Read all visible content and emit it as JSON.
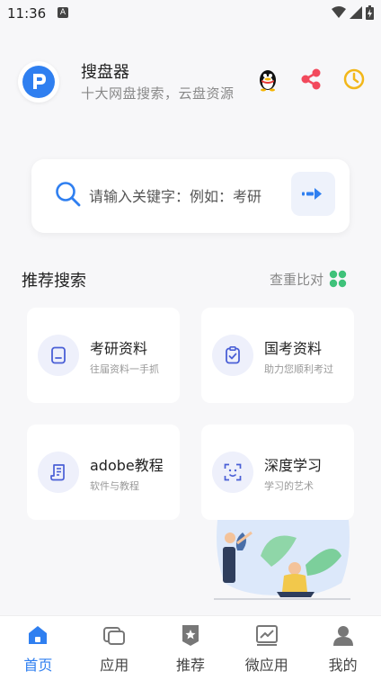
{
  "status": {
    "time": "11:36",
    "notification_glyph": "A"
  },
  "header": {
    "title": "搜盘器",
    "subtitle": "十大网盘搜索，云盘资源",
    "icons": [
      "penguin-icon",
      "share-icon",
      "history-icon"
    ]
  },
  "search": {
    "placeholder": "请输入关键字：例如：考研"
  },
  "section": {
    "title": "推荐搜索",
    "link": "查重比对"
  },
  "cards": [
    {
      "title": "考研资料",
      "subtitle": "往届资料一手抓",
      "icon": "document-icon"
    },
    {
      "title": "国考资料",
      "subtitle": "助力您顺利考过",
      "icon": "clipboard-check-icon"
    },
    {
      "title": "adobe教程",
      "subtitle": "软件与教程",
      "icon": "scroll-icon"
    },
    {
      "title": "深度学习",
      "subtitle": "学习的艺术",
      "icon": "face-scan-icon"
    }
  ],
  "tabs": [
    {
      "label": "首页",
      "icon": "home-icon",
      "active": true
    },
    {
      "label": "应用",
      "icon": "apps-icon",
      "active": false
    },
    {
      "label": "推荐",
      "icon": "badge-icon",
      "active": false
    },
    {
      "label": "微应用",
      "icon": "chart-icon",
      "active": false
    },
    {
      "label": "我的",
      "icon": "user-icon",
      "active": false
    }
  ],
  "colors": {
    "accent": "#2f7ff0",
    "card_icon_bg": "#eef0fb",
    "share": "#f2495c",
    "history": "#f2b71a",
    "grid": "#3fc27a"
  }
}
